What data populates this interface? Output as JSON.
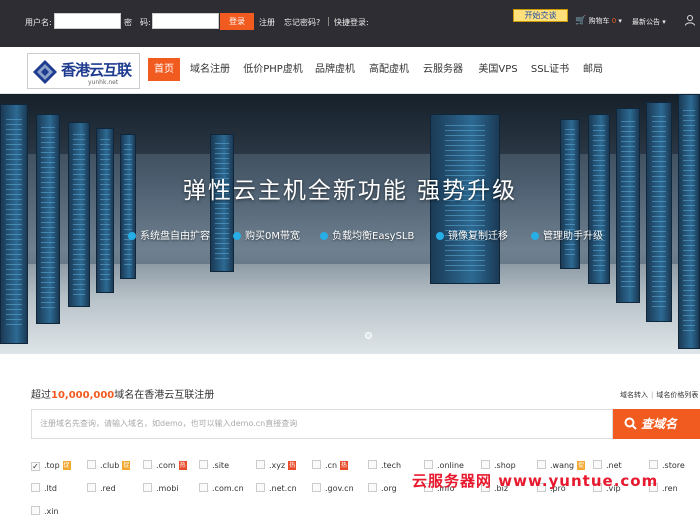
{
  "topbar": {
    "username_label": "用户名:",
    "password_label": "密　码:",
    "username_value": "",
    "password_value": "",
    "login_label": "登录",
    "register_label": "注册",
    "forgot_label": "忘记密码?",
    "quick_login_label": "快捷登录:",
    "qq_label": "开始交谈",
    "cart_label": "购物车",
    "cart_count": "0",
    "news_label": "最新公告"
  },
  "logo": {
    "name": "香港云互联",
    "domain": "yunhk.net"
  },
  "nav": {
    "items": [
      "首页",
      "域名注册",
      "低价PHP虚机",
      "品牌虚机",
      "高配虚机",
      "云服务器",
      "美国VPS",
      "SSL证书",
      "邮局"
    ]
  },
  "banner": {
    "headline": "弹性云主机全新功能  强势升级",
    "features": [
      "系统盘自由扩容",
      "购买0M带宽",
      "负载均衡EasySLB",
      "镜像复制迁移",
      "管理助手升级"
    ]
  },
  "domain": {
    "title_prefix": "超过",
    "title_number": "10,000,000",
    "title_suffix": "域名在香港云互联注册",
    "transfer_link": "域名转入",
    "price_link": "域名价格列表",
    "search_placeholder": "注册域名先查询，请输入域名，如demo，也可以输入demo.cn直接查询",
    "search_button": "查域名",
    "hot_badge": "热",
    "pref_badge": "促",
    "tlds": [
      {
        "name": ".top",
        "checked": true,
        "badge": "pref"
      },
      {
        "name": ".club",
        "checked": false,
        "badge": "pref"
      },
      {
        "name": ".com",
        "checked": false,
        "badge": "hot"
      },
      {
        "name": ".site",
        "checked": false,
        "badge": ""
      },
      {
        "name": ".xyz",
        "checked": false,
        "badge": "hot"
      },
      {
        "name": ".cn",
        "checked": false,
        "badge": "hot"
      },
      {
        "name": ".tech",
        "checked": false,
        "badge": ""
      },
      {
        "name": ".online",
        "checked": false,
        "badge": ""
      },
      {
        "name": ".shop",
        "checked": false,
        "badge": ""
      },
      {
        "name": ".wang",
        "checked": false,
        "badge": "pref"
      },
      {
        "name": ".net",
        "checked": false,
        "badge": ""
      },
      {
        "name": ".store",
        "checked": false,
        "badge": ""
      },
      {
        "name": ".ltd",
        "checked": false,
        "badge": ""
      },
      {
        "name": ".red",
        "checked": false,
        "badge": ""
      },
      {
        "name": ".mobi",
        "checked": false,
        "badge": ""
      },
      {
        "name": ".com.cn",
        "checked": false,
        "badge": ""
      },
      {
        "name": ".net.cn",
        "checked": false,
        "badge": ""
      },
      {
        "name": ".gov.cn",
        "checked": false,
        "badge": ""
      },
      {
        "name": ".org",
        "checked": false,
        "badge": ""
      },
      {
        "name": ".info",
        "checked": false,
        "badge": ""
      },
      {
        "name": ".biz",
        "checked": false,
        "badge": ""
      },
      {
        "name": ".pro",
        "checked": false,
        "badge": ""
      },
      {
        "name": ".vip",
        "checked": false,
        "badge": ""
      },
      {
        "name": ".ren",
        "checked": false,
        "badge": ""
      },
      {
        "name": ".xin",
        "checked": false,
        "badge": ""
      }
    ]
  },
  "watermark": "云服务器网 www.yuntue.com",
  "colors": {
    "accent": "#f25b20",
    "topbar_bg": "#2d2d33",
    "feature_dot": "#27aee6"
  }
}
